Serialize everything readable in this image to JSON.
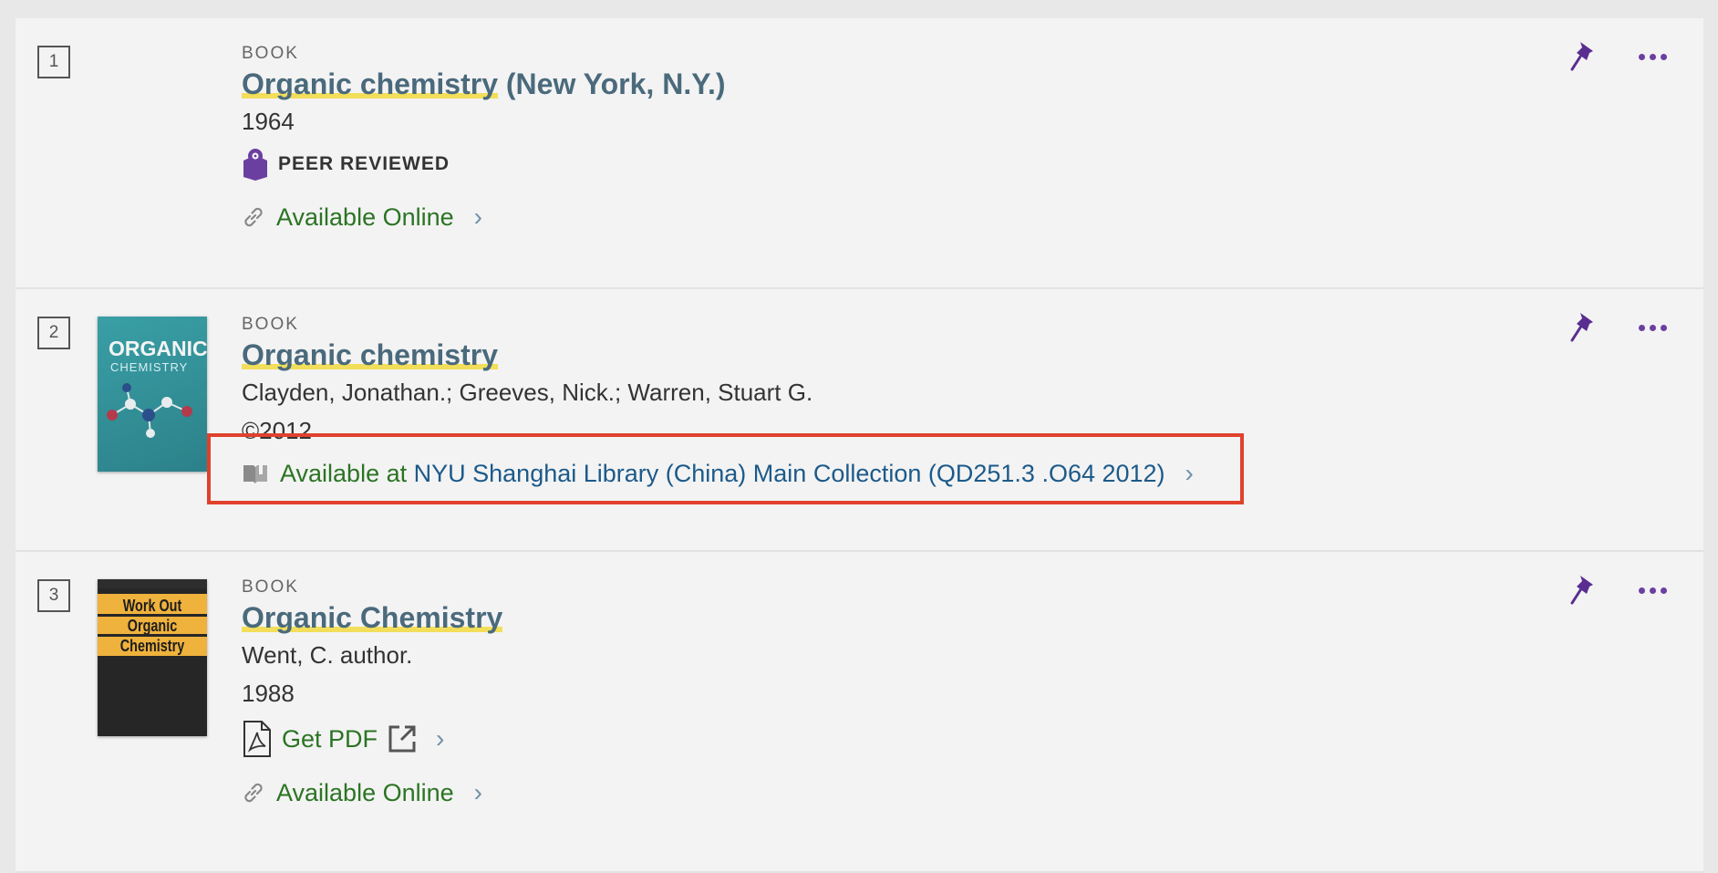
{
  "results": [
    {
      "number": "1",
      "type": "BOOK",
      "title_main": "Organic chemistry",
      "title_rest": "(New York, N.Y.)",
      "year": "1964",
      "peer_reviewed": "PEER REVIEWED",
      "availability": "Available Online"
    },
    {
      "number": "2",
      "type": "BOOK",
      "title_main": "Organic chemistry",
      "authors": "Clayden, Jonathan.; Greeves, Nick.; Warren, Stuart G.",
      "year": "©2012",
      "availability_prefix": "Available at",
      "availability_location": "NYU Shanghai Library (China)  Main Collection (QD251.3 .O64 2012)",
      "cover_title": "ORGANIC",
      "cover_subtitle": "CHEMISTRY"
    },
    {
      "number": "3",
      "type": "BOOK",
      "title_main": "Organic Chemistry",
      "authors": "Went, C. author.",
      "year": "1988",
      "get_pdf": "Get PDF",
      "availability": "Available Online",
      "cover_line1": "Work Out",
      "cover_line2": "Organic",
      "cover_line3": "Chemistry"
    }
  ],
  "icons": {
    "pin": "pin-icon",
    "more": "more-options-icon",
    "link": "link-icon",
    "book": "book-icon",
    "pdf": "pdf-icon",
    "external": "external-link-icon",
    "peer": "peer-reviewed-icon"
  },
  "colors": {
    "accent_purple": "#6b3fa0",
    "available_green": "#2b7423",
    "title_blue": "#4a6a7c",
    "highlight_yellow": "#f2de5a",
    "annotation_red": "#e0412d"
  }
}
